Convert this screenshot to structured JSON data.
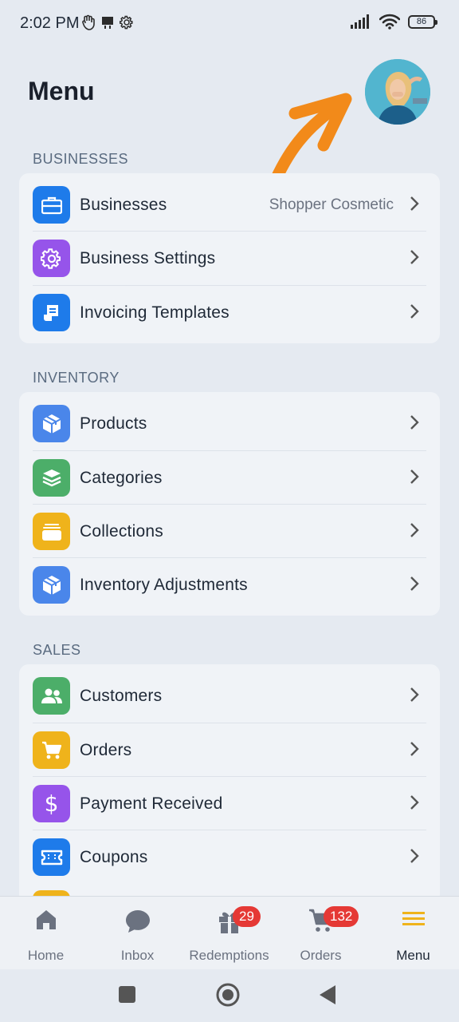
{
  "status_bar": {
    "time": "2:02 PM",
    "battery": "86"
  },
  "header": {
    "title": "Menu"
  },
  "colors": {
    "background": "#e5eaf1",
    "card": "#f0f3f7",
    "blue": "#1e7bea",
    "purple": "#9654ea",
    "green": "#4cae69",
    "yellow": "#efb31b",
    "badge": "#e53935",
    "arrow": "#f28a1a",
    "active_nav": "#efb31b"
  },
  "sections": {
    "businesses": {
      "title": "BUSINESSES",
      "items": [
        {
          "label": "Businesses",
          "value": "Shopper Cosmetic",
          "icon": "briefcase-icon"
        },
        {
          "label": "Business Settings",
          "icon": "gear-icon"
        },
        {
          "label": "Invoicing Templates",
          "icon": "receipt-icon"
        }
      ]
    },
    "inventory": {
      "title": "INVENTORY",
      "items": [
        {
          "label": "Products",
          "icon": "box-icon"
        },
        {
          "label": "Categories",
          "icon": "layers-icon"
        },
        {
          "label": "Collections",
          "icon": "collection-icon"
        },
        {
          "label": "Inventory Adjustments",
          "icon": "box-icon"
        }
      ]
    },
    "sales": {
      "title": "SALES",
      "items": [
        {
          "label": "Customers",
          "icon": "users-icon"
        },
        {
          "label": "Orders",
          "icon": "cart-icon"
        },
        {
          "label": "Payment Received",
          "icon": "dollar-icon"
        },
        {
          "label": "Coupons",
          "icon": "ticket-icon"
        }
      ]
    }
  },
  "bottom_nav": {
    "items": [
      {
        "label": "Home",
        "icon": "home-icon"
      },
      {
        "label": "Inbox",
        "icon": "chat-icon"
      },
      {
        "label": "Redemptions",
        "icon": "gift-icon",
        "badge": "29"
      },
      {
        "label": "Orders",
        "icon": "cart-icon",
        "badge": "132"
      },
      {
        "label": "Menu",
        "icon": "hamburger-icon",
        "active": true
      }
    ]
  }
}
